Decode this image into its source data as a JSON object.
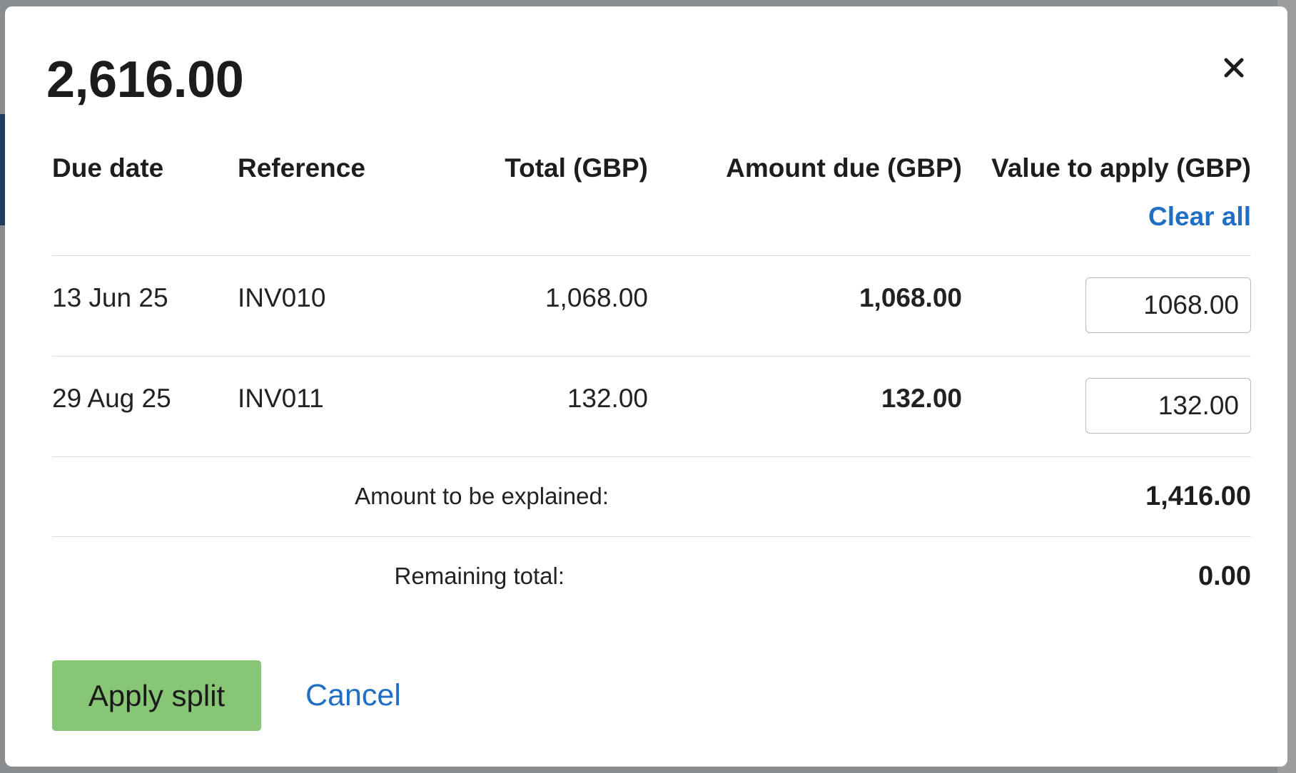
{
  "modal": {
    "title": "2,616.00"
  },
  "table": {
    "headers": {
      "due_date": "Due date",
      "reference": "Reference",
      "total": "Total (GBP)",
      "amount_due": "Amount due (GBP)",
      "value_to_apply": "Value to apply (GBP)"
    },
    "clear_all": "Clear all",
    "rows": [
      {
        "due_date": "13 Jun 25",
        "reference": "INV010",
        "total": "1,068.00",
        "amount_due": "1,068.00",
        "value": "1068.00"
      },
      {
        "due_date": "29 Aug 25",
        "reference": "INV011",
        "total": "132.00",
        "amount_due": "132.00",
        "value": "132.00"
      }
    ]
  },
  "summary": {
    "explained_label": "Amount to be explained:",
    "explained_value": "1,416.00",
    "remaining_label": "Remaining total:",
    "remaining_value": "0.00"
  },
  "actions": {
    "apply_label": "Apply split",
    "cancel_label": "Cancel"
  },
  "colors": {
    "accent": "#1f6fc5",
    "apply_button": "#86c675"
  }
}
